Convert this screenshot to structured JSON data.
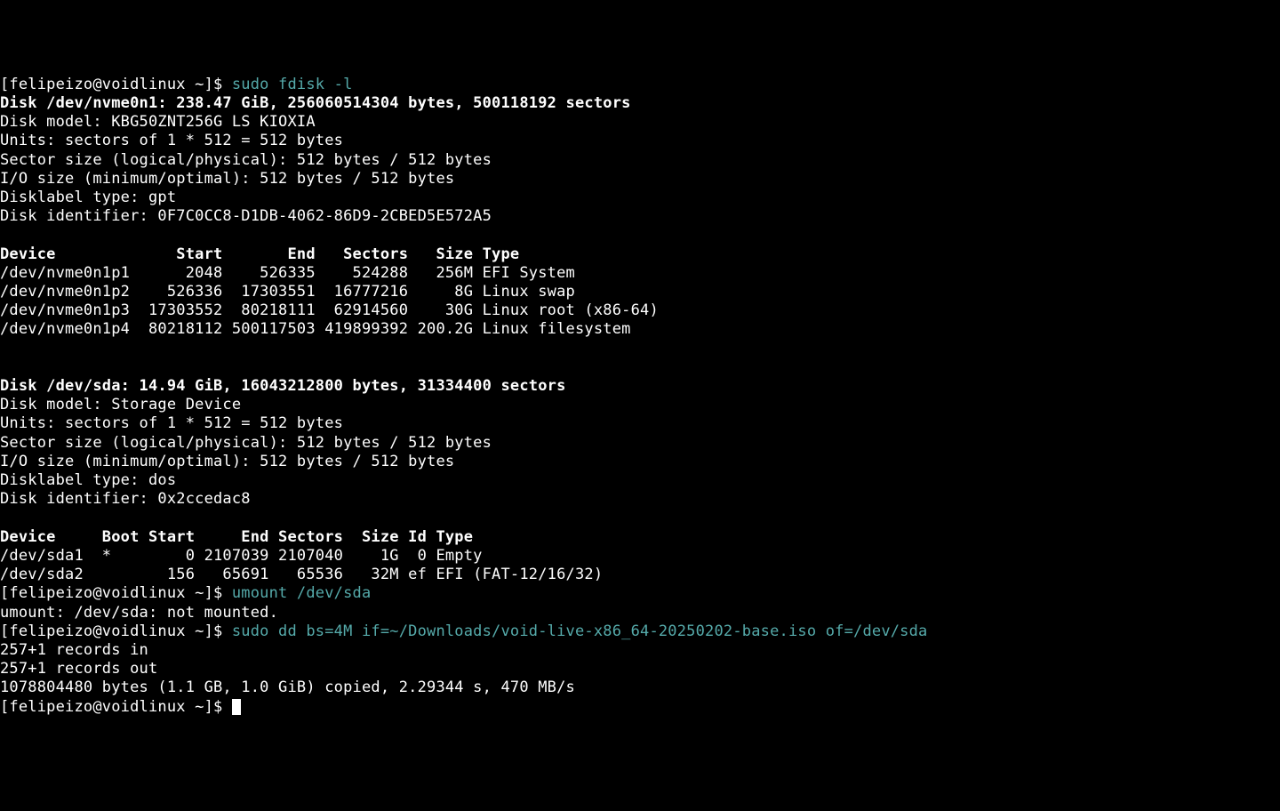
{
  "prompt": "[felipeizo@voidlinux ~]$",
  "cmd1": " sudo fdisk -l",
  "disk1": {
    "hdr": "Disk /dev/nvme0n1: 238.47 GiB, 256060514304 bytes, 500118192 sectors",
    "model": "Disk model: KBG50ZNT256G LS KIOXIA",
    "units": "Units: sectors of 1 * 512 = 512 bytes",
    "sector": "Sector size (logical/physical): 512 bytes / 512 bytes",
    "io": "I/O size (minimum/optimal): 512 bytes / 512 bytes",
    "label": "Disklabel type: gpt",
    "id": "Disk identifier: 0F7C0CC8-D1DB-4062-86D9-2CBED5E572A5",
    "thdr": "Device             Start       End   Sectors   Size Type",
    "p1": "/dev/nvme0n1p1      2048    526335    524288   256M EFI System",
    "p2": "/dev/nvme0n1p2    526336  17303551  16777216     8G Linux swap",
    "p3": "/dev/nvme0n1p3  17303552  80218111  62914560    30G Linux root (x86-64)",
    "p4": "/dev/nvme0n1p4  80218112 500117503 419899392 200.2G Linux filesystem"
  },
  "disk2": {
    "hdr": "Disk /dev/sda: 14.94 GiB, 16043212800 bytes, 31334400 sectors",
    "model": "Disk model: Storage Device",
    "units": "Units: sectors of 1 * 512 = 512 bytes",
    "sector": "Sector size (logical/physical): 512 bytes / 512 bytes",
    "io": "I/O size (minimum/optimal): 512 bytes / 512 bytes",
    "label": "Disklabel type: dos",
    "id": "Disk identifier: 0x2ccedac8",
    "thdr": "Device     Boot Start     End Sectors  Size Id Type",
    "p1": "/dev/sda1  *        0 2107039 2107040    1G  0 Empty",
    "p2": "/dev/sda2         156   65691   65536   32M ef EFI (FAT-12/16/32)"
  },
  "cmd2": " umount /dev/sda",
  "umount_out": "umount: /dev/sda: not mounted.",
  "cmd3": " sudo dd bs=4M if=~/Downloads/void-live-x86_64-20250202-base.iso of=/dev/sda",
  "dd_out1": "257+1 records in",
  "dd_out2": "257+1 records out",
  "dd_out3": "1078804480 bytes (1.1 GB, 1.0 GiB) copied, 2.29344 s, 470 MB/s"
}
